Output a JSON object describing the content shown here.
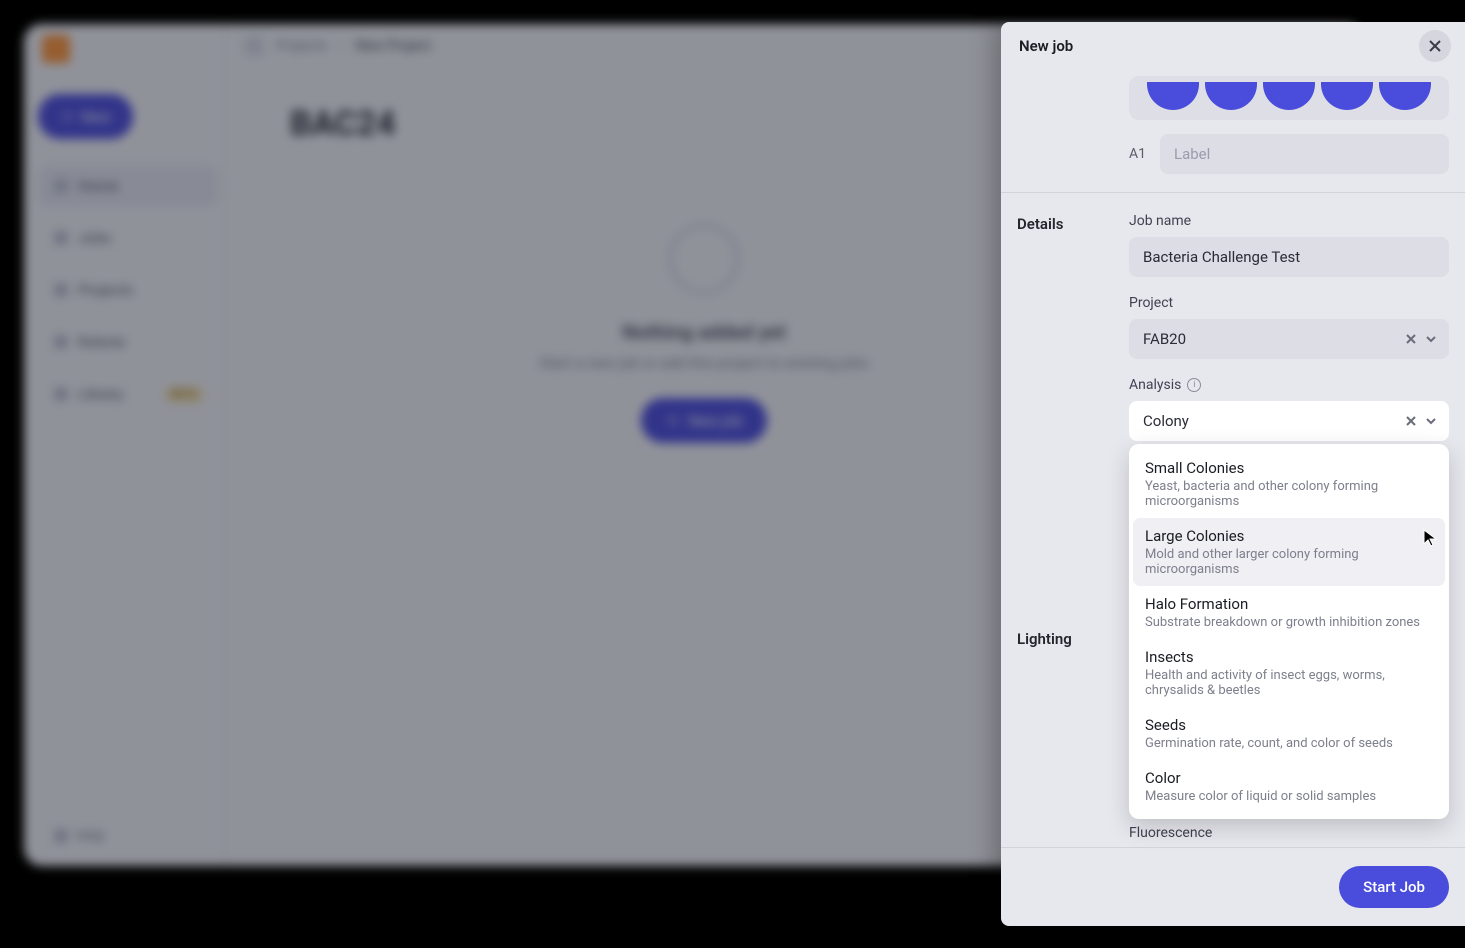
{
  "bg": {
    "new_btn": "New",
    "nav": [
      "Home",
      "Jobs",
      "Projects",
      "Robots",
      "Library"
    ],
    "beta": "BETA",
    "help": "Help",
    "crumbs": {
      "projects": "Projects",
      "current": "New Project"
    },
    "title": "BAC24",
    "empty": {
      "heading": "Nothing added yet",
      "sub": "Start a new job or add this project to existing jobs",
      "btn": "New job"
    }
  },
  "drawer": {
    "title": "New job",
    "well_code": "A1",
    "label_placeholder": "Label",
    "sections": {
      "details": "Details",
      "lighting": "Lighting"
    },
    "fields": {
      "job_name_label": "Job name",
      "job_name_value": "Bacteria Challenge Test",
      "project_label": "Project",
      "project_value": "FAB20",
      "analysis_label": "Analysis",
      "analysis_value": "Colony",
      "fluorescence_label": "Fluorescence"
    },
    "options": [
      {
        "t": "Small Colonies",
        "s": "Yeast, bacteria and other colony forming microorganisms"
      },
      {
        "t": "Large Colonies",
        "s": "Mold and other larger colony forming microorganisms"
      },
      {
        "t": "Halo Formation",
        "s": "Substrate breakdown or growth inhibition zones"
      },
      {
        "t": "Insects",
        "s": "Health and activity of insect eggs, worms, chrysalids & beetles"
      },
      {
        "t": "Seeds",
        "s": "Germination rate, count, and color of seeds"
      },
      {
        "t": "Color",
        "s": "Measure color of liquid or solid samples"
      }
    ],
    "start_btn": "Start Job"
  }
}
